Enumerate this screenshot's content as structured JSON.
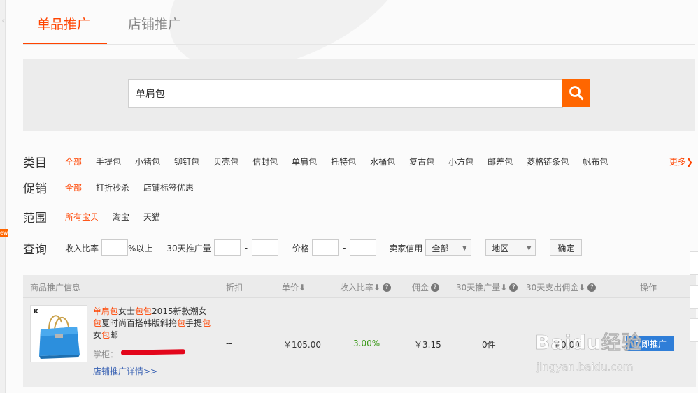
{
  "tabs": [
    {
      "label": "单品推广",
      "active": true
    },
    {
      "label": "店铺推广",
      "active": false
    }
  ],
  "search": {
    "value": "单肩包",
    "button_icon": "search-icon"
  },
  "filters": {
    "category": {
      "label": "类目",
      "options": [
        "全部",
        "手提包",
        "小猪包",
        "铆钉包",
        "贝壳包",
        "信封包",
        "单肩包",
        "托特包",
        "水桶包",
        "复古包",
        "小方包",
        "邮差包",
        "菱格链条包",
        "帆布包"
      ],
      "more": "更多"
    },
    "promotion": {
      "label": "促销",
      "options": [
        "全部",
        "打折秒杀",
        "店铺标签优惠"
      ]
    },
    "scope": {
      "label": "范围",
      "options": [
        "所有宝贝",
        "淘宝",
        "天猫"
      ]
    },
    "query": {
      "label": "查询",
      "income_label": "收入比率",
      "income_suffix": "%以上",
      "volume_label": "30天推广量",
      "dash": "-",
      "price_label": "价格",
      "credit_label": "卖家信用",
      "credit_value": "全部",
      "region_value": "地区",
      "confirm_label": "确定"
    }
  },
  "table": {
    "headers": {
      "info": "商品推广信息",
      "discount": "折扣",
      "price": "单价",
      "income": "收入比率",
      "commission": "佣金",
      "volume": "30天推广量",
      "spend": "30天支出佣金",
      "action": "操作"
    },
    "row": {
      "title_parts": [
        {
          "text": "单肩包",
          "hl": true
        },
        {
          "text": "女士",
          "hl": false
        },
        {
          "text": "包包",
          "hl": true
        },
        {
          "text": "2015新款潮女",
          "hl": false
        },
        {
          "text": "包",
          "hl": true
        },
        {
          "text": "夏时尚百搭韩版斜挎",
          "hl": false
        },
        {
          "text": "包",
          "hl": true
        },
        {
          "text": "手提",
          "hl": false
        },
        {
          "text": "包",
          "hl": true
        },
        {
          "text": "女",
          "hl": false
        },
        {
          "text": "包",
          "hl": true
        },
        {
          "text": "邮",
          "hl": false
        }
      ],
      "shop_label": "掌柜：",
      "shop_link": "店铺推广详情>>",
      "discount": "--",
      "price": "￥105.00",
      "income": "3.00%",
      "commission": "￥3.15",
      "volume": "0件",
      "spend": "￥0.00",
      "action_button": "立即推广",
      "thumb_brand": "K"
    }
  },
  "watermark": {
    "main": "Baidu经验",
    "sub": "jingyan.baidu.com"
  },
  "colors": {
    "accent": "#ff4400",
    "search_button": "#ff6600",
    "link": "#3c64b4",
    "income_green": "#3c9a1b",
    "promo_button": "#2f7ed8"
  }
}
